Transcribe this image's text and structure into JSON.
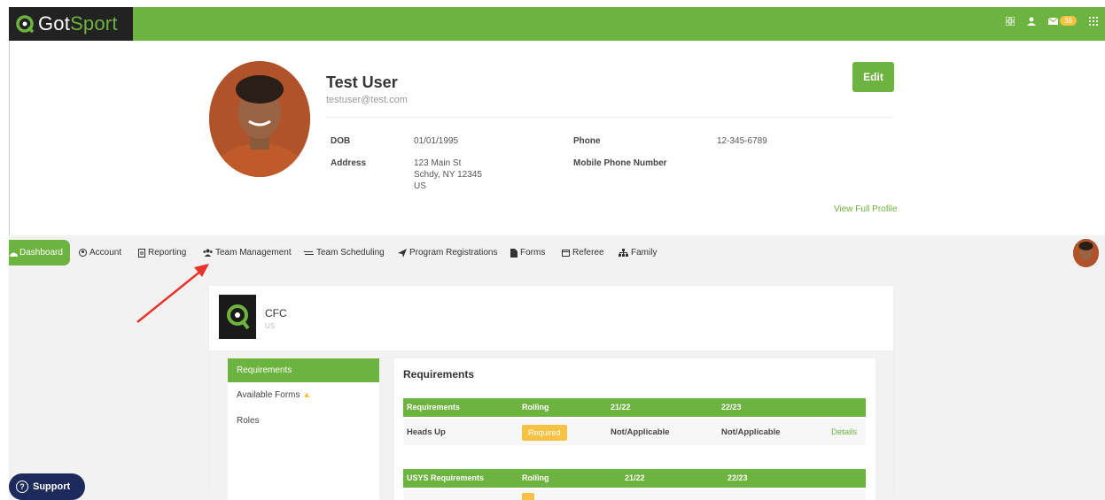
{
  "brand": {
    "logo_text_1": "Got",
    "logo_text_2": "Sport",
    "accent": "#6db33f",
    "dark": "#222222"
  },
  "topbar": {
    "mail_badge": "36",
    "icons": [
      "grid-icon",
      "user-icon",
      "mail-icon",
      "apps-icon"
    ]
  },
  "profile": {
    "name": "Test User",
    "email": "testuser@test.com",
    "edit_label": "Edit",
    "dob_label": "DOB",
    "dob": "01/01/1995",
    "address_label": "Address",
    "address_line1": "123 Main St",
    "address_line2": "Schdy, NY 12345",
    "address_line3": "US",
    "phone_label": "Phone",
    "phone": "12-345-6789",
    "mobile_label": "Mobile Phone Number",
    "view_full": "View Full Profile"
  },
  "nav": {
    "items": [
      {
        "label": "Dashboard",
        "icon": "dashboard-icon"
      },
      {
        "label": "Account",
        "icon": "account-icon"
      },
      {
        "label": "Reporting",
        "icon": "reporting-icon"
      },
      {
        "label": "Team Management",
        "icon": "team-icon"
      },
      {
        "label": "Team Scheduling",
        "icon": "swap-icon"
      },
      {
        "label": "Program Registrations",
        "icon": "send-icon"
      },
      {
        "label": "Forms",
        "icon": "file-icon"
      },
      {
        "label": "Referee",
        "icon": "calendar-icon"
      },
      {
        "label": "Family",
        "icon": "family-icon"
      }
    ]
  },
  "org": {
    "name": "CFC",
    "country": "US"
  },
  "side": {
    "items": [
      "Requirements",
      "Available Forms",
      "Roles"
    ]
  },
  "requirements": {
    "title": "Requirements",
    "table1": {
      "headers": [
        "Requirements",
        "Rolling",
        "21/22",
        "22/23"
      ],
      "rows": [
        {
          "name": "Heads Up",
          "rolling": "Required",
          "s2122": "Not/Applicable",
          "s2223": "Not/Applicable",
          "action": "Details"
        }
      ]
    },
    "table2": {
      "headers": [
        "USYS Requirements",
        "Rolling",
        "21/22",
        "22/23"
      ]
    }
  },
  "support": {
    "label": "Support"
  }
}
